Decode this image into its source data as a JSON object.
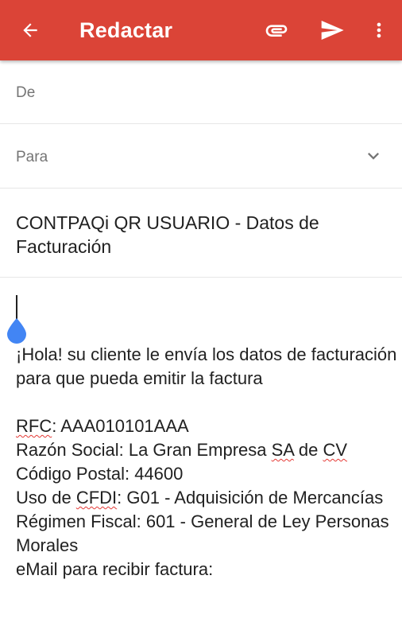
{
  "header": {
    "title": "Redactar",
    "background_color": "#db4437",
    "icons": [
      "back-arrow-icon",
      "attachment-icon",
      "send-icon",
      "more-vert-icon"
    ]
  },
  "fields": {
    "from_label": "De",
    "to_label": "Para",
    "subject": "CONTPAQi QR USUARIO - Datos de Facturación"
  },
  "body": {
    "greeting": "¡Hola! su cliente le envía los datos de facturación para que pueda emitir la factura",
    "rfc_label": "RFC",
    "rfc_value": ": AAA010101AAA",
    "razon_prefix": "Razón Social: La Gran Empresa ",
    "razon_sa": "SA",
    "razon_de": " de ",
    "razon_cv": "CV",
    "cp_line": "Código Postal: 44600",
    "uso_prefix": "Uso de ",
    "uso_cfdi": "CFDI",
    "uso_suffix": ": G01 - Adquisición de Mercancías",
    "regimen_line": "Régimen Fiscal: 601 - General de Ley Personas Morales",
    "email_line": "eMail para recibir factura:",
    "cursor_handle_color": "#4285f4",
    "spellcheck_color": "#e53935"
  }
}
